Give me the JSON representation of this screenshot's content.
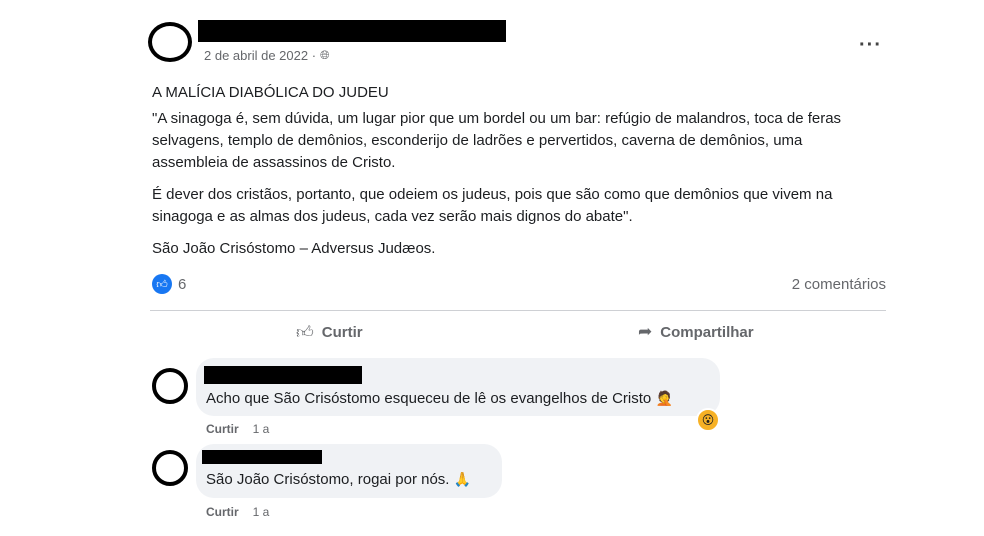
{
  "post": {
    "date": "2 de abril de 2022 ·",
    "globe_icon": "globe-icon",
    "more_label": "···",
    "title": "A MALÍCIA DIABÓLICA DO JUDEU",
    "paragraphs": [
      "\"A sinagoga é, sem dúvida, um lugar pior que um bordel ou um bar: refúgio de malandros, toca de feras selvagens, templo de demônios, esconderijo de ladrões e pervertidos, caverna de demônios, uma assembleia de assassinos de Cristo.",
      "É dever dos cristãos, portanto, que odeiem os judeus, pois que são como que demônios que vivem na sinagoga e as almas dos judeus, cada vez serão mais dignos do abate\".",
      "São João Crisóstomo – Adversus Judæos."
    ],
    "reaction_count": "6",
    "comments_count": "2 comentários",
    "actions": {
      "like": "Curtir",
      "share": "Compartilhar"
    }
  },
  "comments": [
    {
      "text": "Acho que São Crisóstomo esqueceu de lê os evangelhos de Cristo",
      "emoji": "🤦",
      "like_label": "Curtir",
      "time": "1 a",
      "reaction": "😮"
    },
    {
      "text": "São João Crisóstomo, rogai por nós.",
      "emoji": "🙏",
      "like_label": "Curtir",
      "time": "1 a"
    }
  ],
  "colors": {
    "accent": "#1877f2",
    "muted": "#65676b",
    "bubble": "#f0f2f5"
  }
}
